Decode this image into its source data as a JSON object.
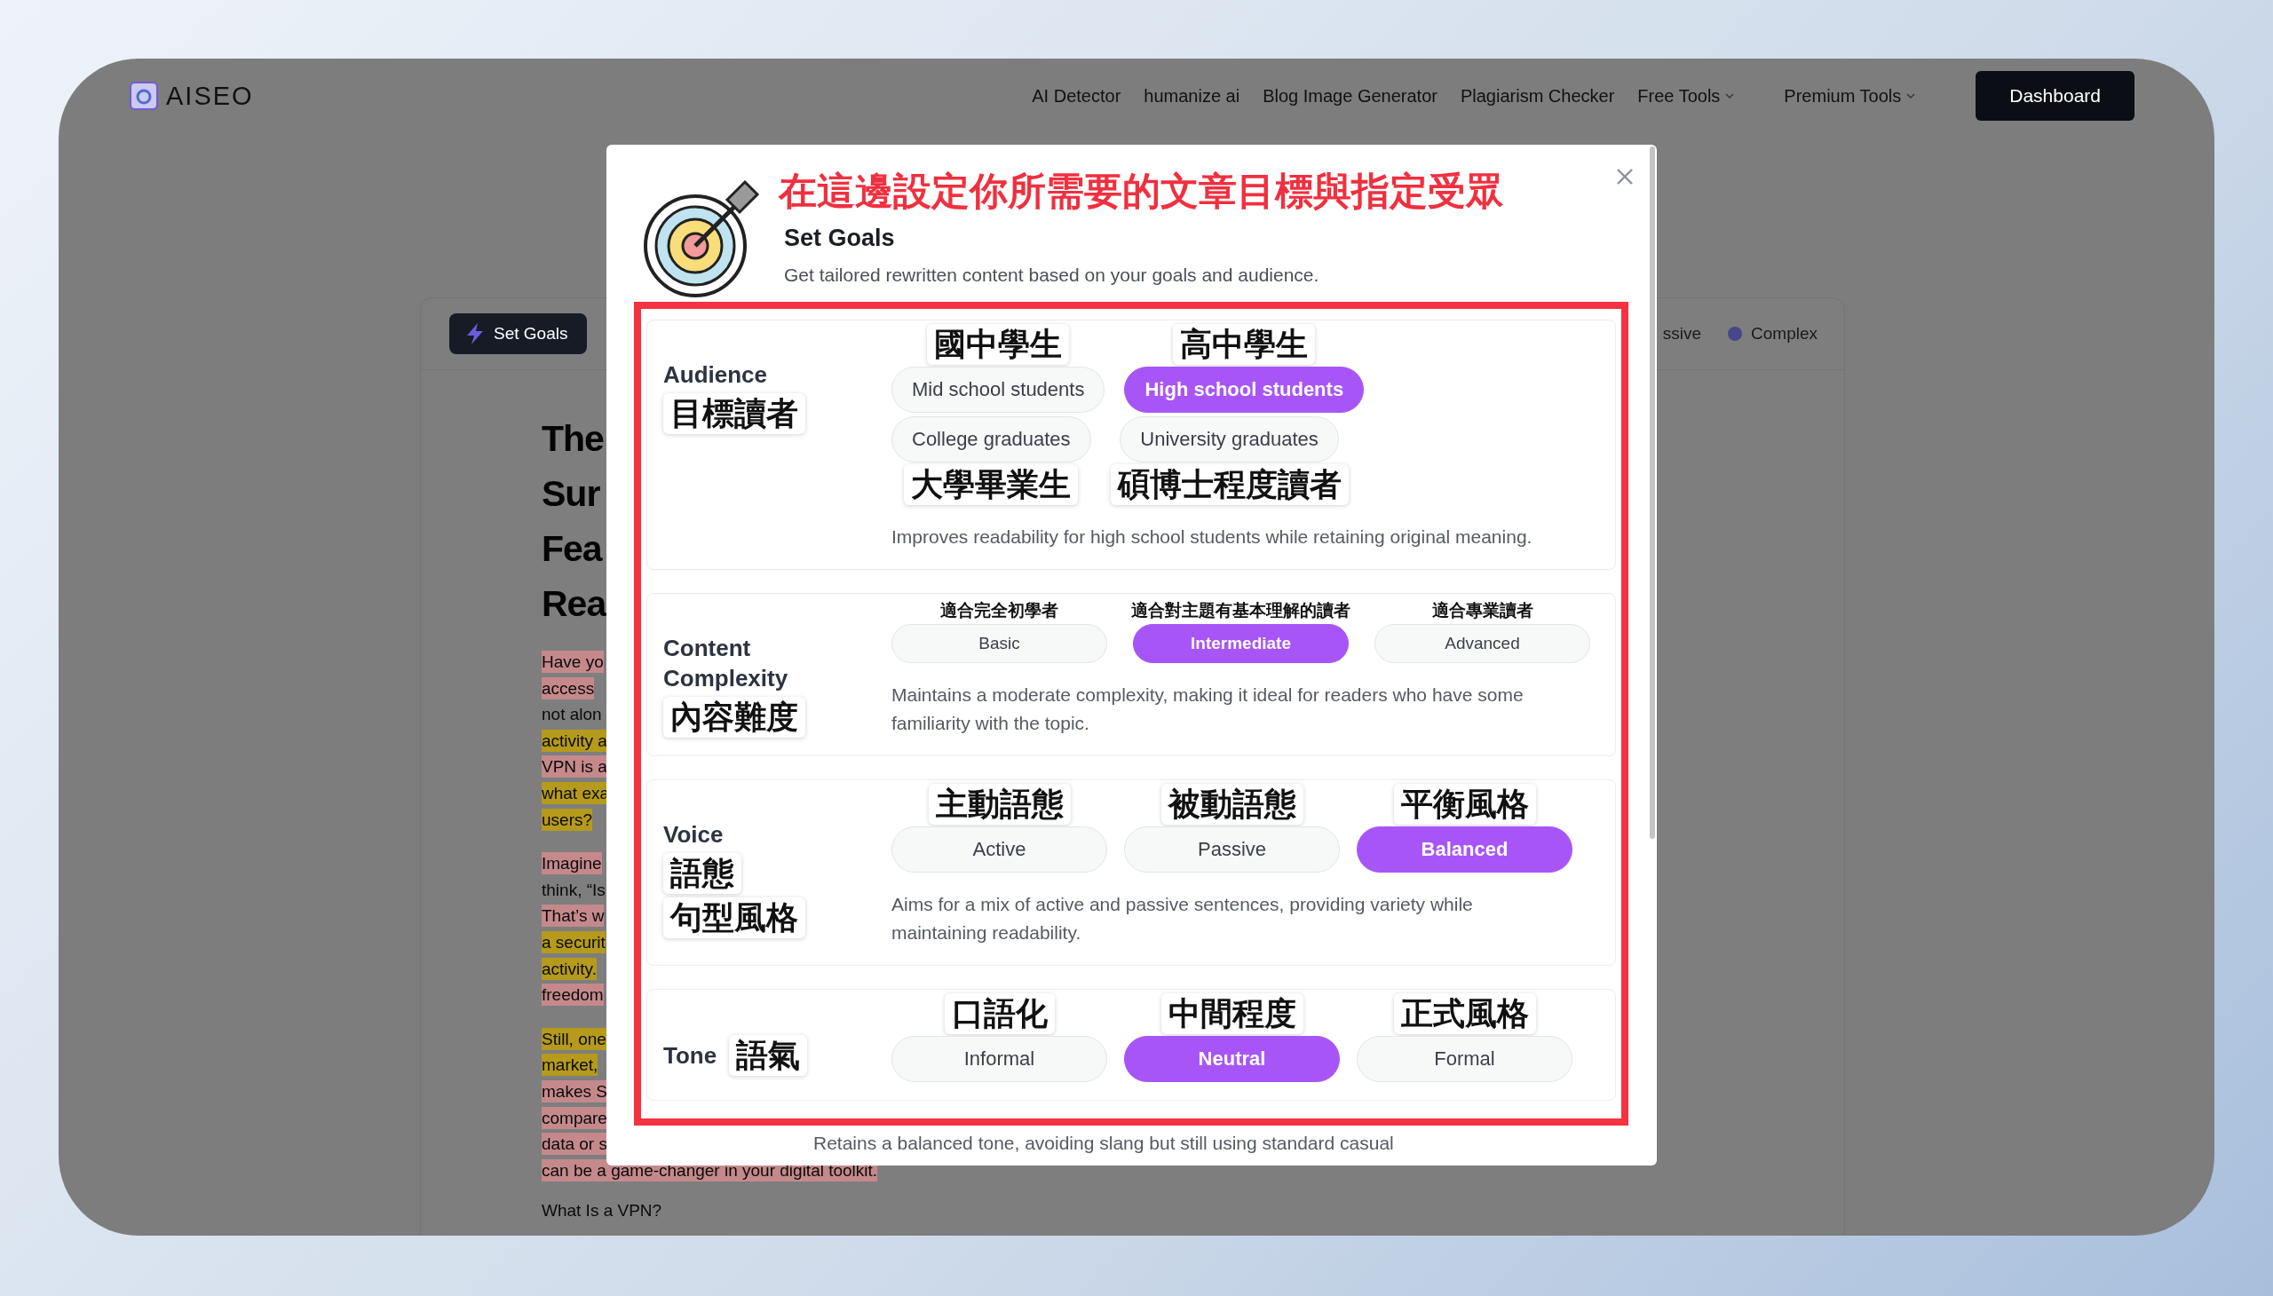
{
  "background_page": {
    "logo": "AISEO",
    "nav": [
      {
        "label": "AI Detector",
        "dropdown": false
      },
      {
        "label": "humanize ai",
        "dropdown": false
      },
      {
        "label": "Blog Image Generator",
        "dropdown": false
      },
      {
        "label": "Plagiarism Checker",
        "dropdown": false
      },
      {
        "label": "Free Tools",
        "dropdown": true
      },
      {
        "label": "Premium Tools",
        "dropdown": true
      }
    ],
    "dashboard_button": "Dashboard",
    "toolbar": {
      "set_goals_button": "Set Goals",
      "legend": [
        {
          "label": "ssive"
        },
        {
          "label": "Complex",
          "color": "#47478a"
        }
      ]
    },
    "article": {
      "title_lines": [
        "The",
        "Sur",
        "Fea",
        "Rea"
      ],
      "paragraphs": [
        [
          {
            "text": "Have yo",
            "color": "#c5898c"
          },
          {
            "text": "access",
            "color": "#c5898c"
          },
          {
            "text": "not alon"
          },
          {
            "text": "activity a",
            "color": "#b59a1c"
          },
          {
            "text": "VPN is a",
            "color": "#c5898c"
          },
          {
            "text": "what exa",
            "color": "#b59a1c"
          },
          {
            "text": "users?",
            "color": "#b59a1c"
          }
        ],
        [
          {
            "text": "Imagine",
            "color": "#c5898c"
          },
          {
            "text": "think, “Is"
          },
          {
            "text": "That’s w",
            "color": "#c5898c"
          },
          {
            "text": "a securit",
            "color": "#b59a1c"
          },
          {
            "text": "activity.",
            "color": "#b59a1c"
          },
          {
            "text": "freedom",
            "color": "#c5898c"
          }
        ],
        [
          {
            "text": "Still, one",
            "color": "#b59a1c"
          },
          {
            "text": "market,",
            "color": "#b59a1c"
          },
          {
            "text": "makes S",
            "color": "#c5898c"
          },
          {
            "text": "compare",
            "color": "#c5898c"
          },
          {
            "text": "data or s",
            "color": "#c5898c"
          },
          {
            "text": "can be a game-changer in your digital toolkit.",
            "color": "#c5898c"
          }
        ]
      ],
      "heading": "What Is a VPN?"
    }
  },
  "modal": {
    "annotation": "在這邊設定你所需要的文章目標與指定受眾",
    "title": "Set Goals",
    "subtitle": "Get tailored rewritten content based on your goals and audience.",
    "sections": [
      {
        "kind": "wrap",
        "label": "Audience",
        "label_notes": [
          "目標讀者"
        ],
        "option_rows": [
          [
            {
              "label": "Mid school students",
              "selected": false,
              "note": "國中學生"
            },
            {
              "label": "High school students",
              "selected": true,
              "note": "高中學生"
            }
          ],
          [
            {
              "label": "College graduates",
              "selected": false,
              "note_below": "大學畢業生"
            },
            {
              "label": "University graduates",
              "selected": false,
              "note_below": "碩博士程度讀者"
            }
          ]
        ],
        "description": "Improves readability for high school students while retaining original meaning."
      },
      {
        "kind": "compact",
        "label": "Content Complexity",
        "label_notes": [
          "內容難度"
        ],
        "option_rows": [
          [
            {
              "label": "Basic",
              "selected": false,
              "note": "適合完全初學者"
            },
            {
              "label": "Intermediate",
              "selected": true,
              "note": "適合對主題有基本理解的讀者"
            },
            {
              "label": "Advanced",
              "selected": false,
              "note": "適合專業讀者"
            }
          ]
        ],
        "description": "Maintains a moderate complexity, making it ideal for readers who have some familiarity with the topic."
      },
      {
        "kind": "regular",
        "label": "Voice",
        "label_notes": [
          "語態",
          "句型風格"
        ],
        "option_rows": [
          [
            {
              "label": "Active",
              "selected": false,
              "note": "主動語態"
            },
            {
              "label": "Passive",
              "selected": false,
              "note": "被動語態"
            },
            {
              "label": "Balanced",
              "selected": true,
              "note": "平衡風格"
            }
          ]
        ],
        "description": "Aims for a mix of active and passive sentences, providing variety while maintaining readability."
      },
      {
        "kind": "inline",
        "label": "Tone",
        "label_notes": [
          "語氣"
        ],
        "option_rows": [
          [
            {
              "label": "Informal",
              "selected": false,
              "note": "口語化"
            },
            {
              "label": "Neutral",
              "selected": true,
              "note": "中間程度"
            },
            {
              "label": "Formal",
              "selected": false,
              "note": "正式風格"
            }
          ]
        ]
      }
    ],
    "footer_text": "Retains a balanced tone, avoiding slang but still using standard casual"
  }
}
